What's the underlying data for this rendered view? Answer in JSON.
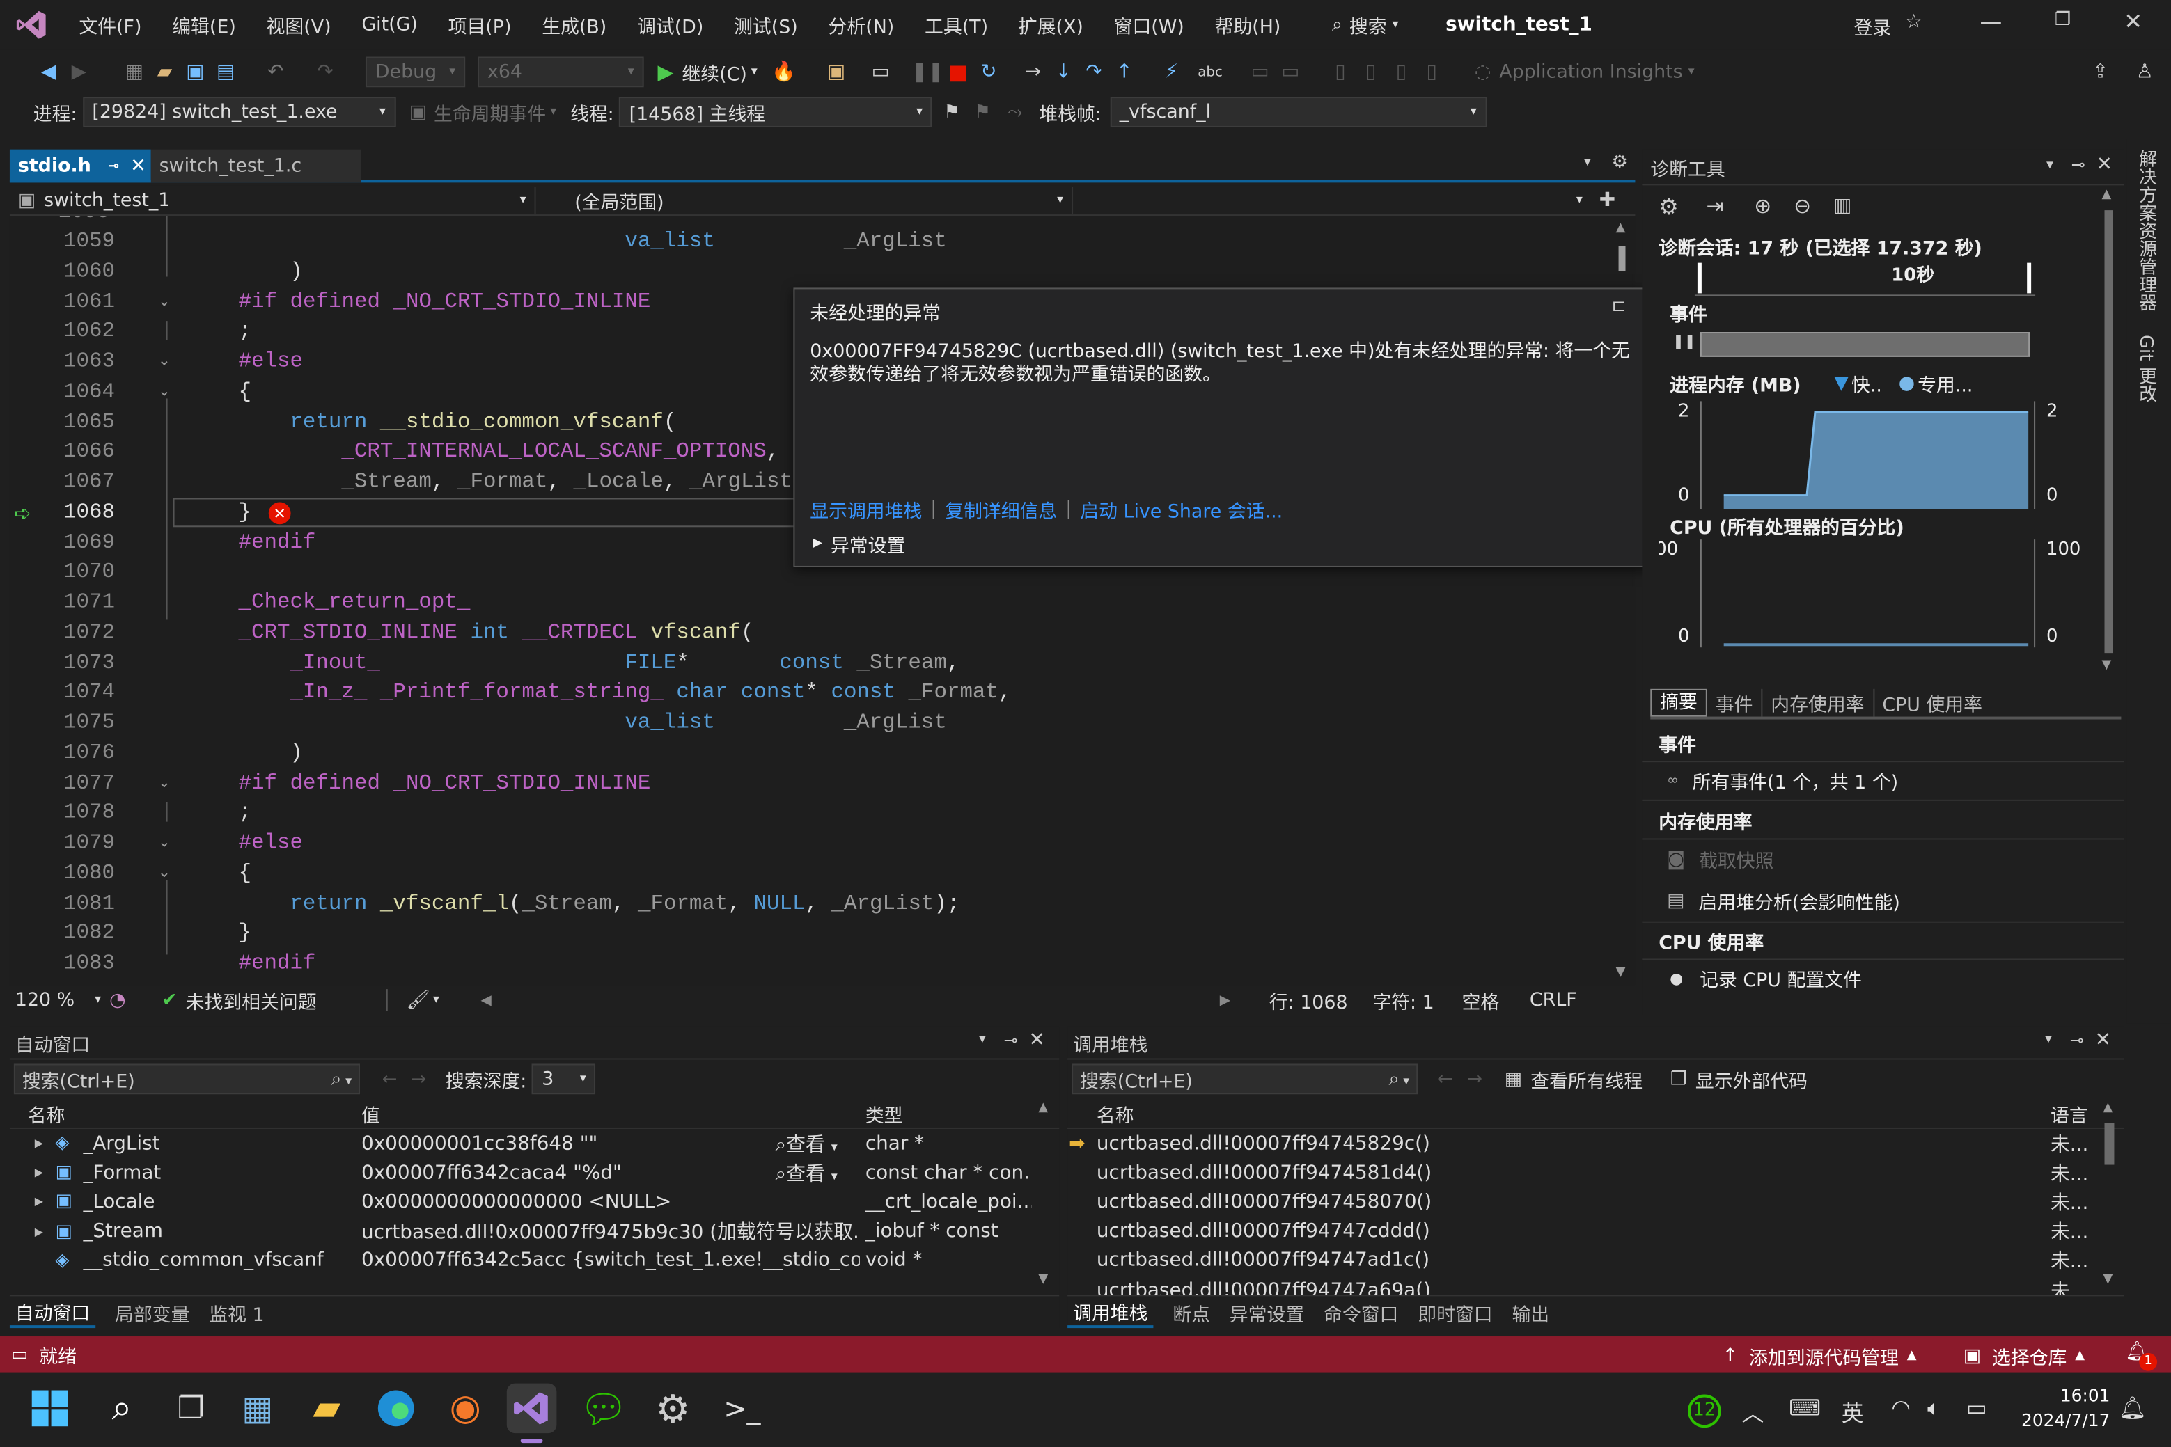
{
  "menubar": {
    "items": [
      "文件(F)",
      "编辑(E)",
      "视图(V)",
      "Git(G)",
      "项目(P)",
      "生成(B)",
      "调试(D)",
      "测试(S)",
      "分析(N)",
      "工具(T)",
      "扩展(X)",
      "窗口(W)",
      "帮助(H)"
    ],
    "search": "搜索",
    "solution_name": "switch_test_1",
    "login": "登录"
  },
  "toolbar": {
    "config": "Debug",
    "platform": "x64",
    "continue": "继续(C)",
    "app_insights": "Application Insights"
  },
  "debugbar": {
    "process_label": "进程:",
    "process_value": "[29824] switch_test_1.exe",
    "lifecycle": "生命周期事件",
    "thread_label": "线程:",
    "thread_value": "[14568] 主线程",
    "stackframe_label": "堆栈帧:",
    "stackframe_value": "_vfscanf_l"
  },
  "editor": {
    "tabs": [
      {
        "label": "stdio.h",
        "active": true
      },
      {
        "label": "switch_test_1.c",
        "active": false
      }
    ],
    "project_nav": "switch_test_1",
    "scope_nav": "(全局范围)",
    "zoom": "120 %",
    "issues": "未找到相关问题",
    "line_status": "行: 1068",
    "char_status": "字符: 1",
    "space_status": "空格",
    "eol_status": "CRLF",
    "lines": [
      {
        "n": "1059",
        "t": "                                  va_list          _ArgList"
      },
      {
        "n": "1060",
        "t": "        )"
      },
      {
        "n": "1061",
        "t": "    #if defined _NO_CRT_STDIO_INLINE"
      },
      {
        "n": "1062",
        "t": "    ;"
      },
      {
        "n": "1063",
        "t": "    #else"
      },
      {
        "n": "1064",
        "t": "    {"
      },
      {
        "n": "1065",
        "t": "        return __stdio_common_vfscanf("
      },
      {
        "n": "1066",
        "t": "            _CRT_INTERNAL_LOCAL_SCANF_OPTIONS,"
      },
      {
        "n": "1067",
        "t": "            _Stream, _Format, _Locale, _ArgList);"
      },
      {
        "n": "1068",
        "t": "    }"
      },
      {
        "n": "1069",
        "t": "    #endif"
      },
      {
        "n": "1070",
        "t": ""
      },
      {
        "n": "1071",
        "t": "    _Check_return_opt_"
      },
      {
        "n": "1072",
        "t": "    _CRT_STDIO_INLINE int __CRTDECL vfscanf("
      },
      {
        "n": "1073",
        "t": "        _Inout_                   FILE*       const _Stream,"
      },
      {
        "n": "1074",
        "t": "        _In_z_ _Printf_format_string_ char const* const _Format,"
      },
      {
        "n": "1075",
        "t": "                                  va_list          _ArgList"
      },
      {
        "n": "1076",
        "t": "        )"
      },
      {
        "n": "1077",
        "t": "    #if defined _NO_CRT_STDIO_INLINE"
      },
      {
        "n": "1078",
        "t": "    ;"
      },
      {
        "n": "1079",
        "t": "    #else"
      },
      {
        "n": "1080",
        "t": "    {"
      },
      {
        "n": "1081",
        "t": "        return _vfscanf_l(_Stream, _Format, NULL, _ArgList);"
      },
      {
        "n": "1082",
        "t": "    }"
      },
      {
        "n": "1083",
        "t": "    #endif"
      }
    ]
  },
  "exception": {
    "title": "未经处理的异常",
    "message": "0x00007FF94745829C (ucrtbased.dll) (switch_test_1.exe 中)处有未经处理的异常: 将一个无效参数传递给了将无效参数视为严重错误的函数。",
    "link1": "显示调用堆栈",
    "link2": "复制详细信息",
    "link3": "启动 Live Share 会话...",
    "settings": "异常设置"
  },
  "diag": {
    "title": "诊断工具",
    "session": "诊断会话: 17 秒 (已选择 17.372 秒)",
    "timeline_label": "10秒",
    "events_label": "事件",
    "memory_label": "进程内存 (MB)",
    "memory_legend1": "快..",
    "memory_legend2": "专用...",
    "mem_max": "2",
    "mem_min": "0",
    "cpu_label": "CPU (所有处理器的百分比)",
    "cpu_max_left": "100",
    "cpu_max": "100",
    "cpu_min": "0",
    "tabs": [
      "摘要",
      "事件",
      "内存使用率",
      "CPU 使用率"
    ],
    "sec_events": "事件",
    "all_events": "所有事件(1 个，共 1 个)",
    "sec_memory": "内存使用率",
    "snapshot": "截取快照",
    "heap": "启用堆分析(会影响性能)",
    "sec_cpu": "CPU 使用率",
    "cpu_profile": "记录 CPU 配置文件"
  },
  "sidebar_right": [
    "解决方案资源管理器",
    "Git 更改"
  ],
  "autos": {
    "title": "自动窗口",
    "search_placeholder": "搜索(Ctrl+E)",
    "depth_label": "搜索深度:",
    "depth_value": "3",
    "col_name": "名称",
    "col_value": "值",
    "col_type": "类型",
    "view_label": "查看",
    "rows": [
      {
        "name": "_ArgList",
        "value": "0x00000001cc38f648 \"\"",
        "type": "char *",
        "view": true
      },
      {
        "name": "_Format",
        "value": "0x00007ff6342caca4 \"%d\"",
        "type": "const char * con...",
        "view": true
      },
      {
        "name": "_Locale",
        "value": "0x0000000000000000 <NULL>",
        "type": "__crt_locale_poi...",
        "view": false
      },
      {
        "name": "_Stream",
        "value": "ucrtbased.dll!0x00007ff9475b9c30 (加载符号以获取...",
        "type": "_iobuf * const",
        "view": false
      },
      {
        "name": "__stdio_common_vfscanf",
        "value": "0x00007ff6342c5acc {switch_test_1.exe!__stdio_com...",
        "type": "void *",
        "view": false
      }
    ],
    "bottom_tabs": [
      "自动窗口",
      "局部变量",
      "监视 1"
    ]
  },
  "callstack": {
    "title": "调用堆栈",
    "search_placeholder": "搜索(Ctrl+E)",
    "view_threads": "查看所有线程",
    "show_external": "显示外部代码",
    "col_name": "名称",
    "col_lang": "语言",
    "rows": [
      {
        "name": "ucrtbased.dll!00007ff94745829c()",
        "lang": "未..."
      },
      {
        "name": "ucrtbased.dll!00007ff9474581d4()",
        "lang": "未..."
      },
      {
        "name": "ucrtbased.dll!00007ff947458070()",
        "lang": "未..."
      },
      {
        "name": "ucrtbased.dll!00007ff94747cddd()",
        "lang": "未..."
      },
      {
        "name": "ucrtbased.dll!00007ff94747ad1c()",
        "lang": "未..."
      },
      {
        "name": "ucrtbased.dll!00007ff94747a69a()",
        "lang": "未..."
      }
    ],
    "bottom_tabs": [
      "调用堆栈",
      "断点",
      "异常设置",
      "命令窗口",
      "即时窗口",
      "输出"
    ]
  },
  "statusbar": {
    "ready": "就绪",
    "add_source": "添加到源代码管理",
    "select_repo": "选择仓库",
    "notif_count": "1",
    "bg": "#8b1a2b"
  },
  "taskbar": {
    "ime": "英",
    "time": "16:01",
    "date": "2024/7/17",
    "badge": "12"
  }
}
